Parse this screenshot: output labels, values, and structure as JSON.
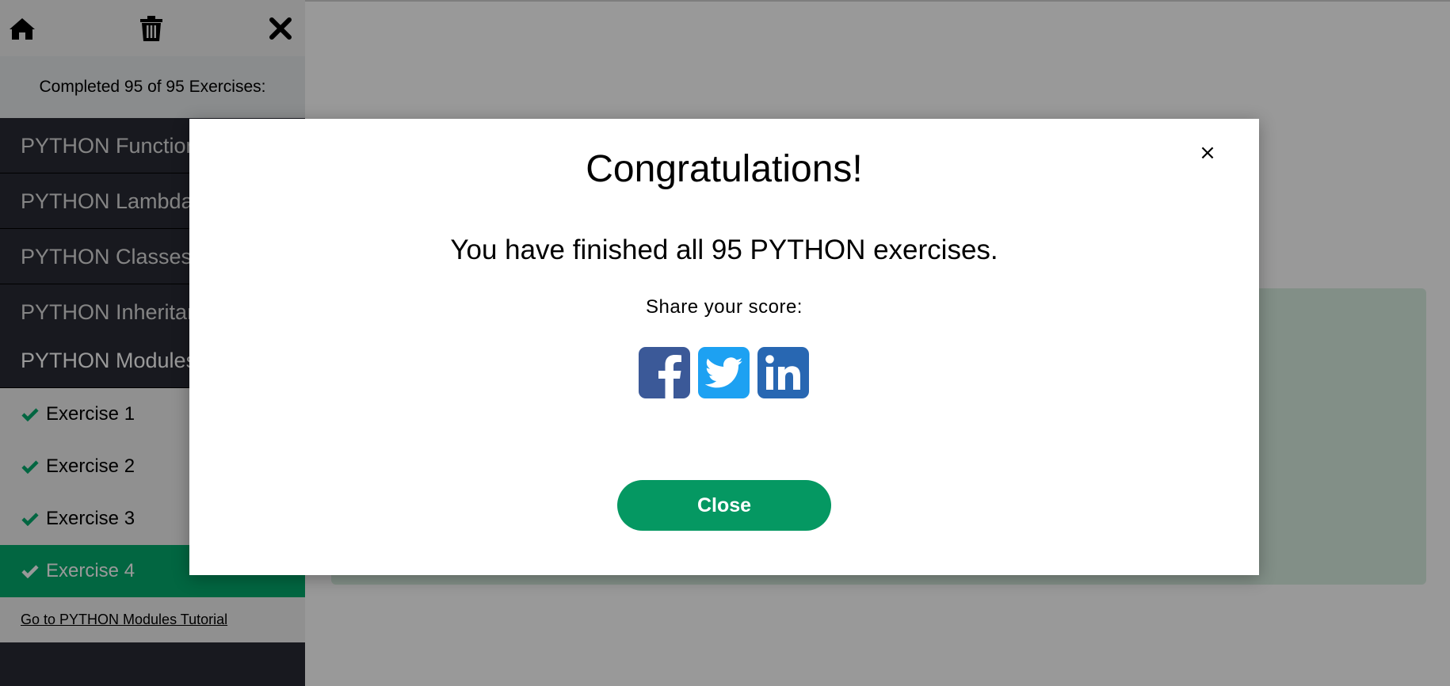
{
  "sidebar": {
    "toolbar": {
      "home_icon": "home-icon",
      "trash_icon": "trash-icon",
      "close_icon": "close-icon"
    },
    "progress_text": "Completed 95 of 95 Exercises:",
    "categories": [
      {
        "label": "PYTHON Functions"
      },
      {
        "label": "PYTHON Lambda"
      },
      {
        "label": "PYTHON Classes"
      },
      {
        "label": "PYTHON Inheritance"
      },
      {
        "label": "PYTHON Modules"
      }
    ],
    "exercises": [
      {
        "label": "Exercise 1",
        "completed": true
      },
      {
        "label": "Exercise 2",
        "completed": true
      },
      {
        "label": "Exercise 3",
        "completed": true
      },
      {
        "label": "Exercise 4",
        "completed": true,
        "current": true
      }
    ],
    "tutorial_link": "Go to PYTHON Modules Tutorial"
  },
  "modal": {
    "close_symbol": "×",
    "title": "Congratulations!",
    "message": "You have finished all 95 PYTHON exercises.",
    "share_label": "Share your score:",
    "social_icons": [
      "facebook-icon",
      "twitter-icon",
      "linkedin-icon"
    ],
    "close_button_label": "Close"
  },
  "colors": {
    "accent_green": "#04aa6d",
    "button_green": "#059862",
    "sidebar_dark": "#282a35",
    "facebook": "#3b5998",
    "twitter": "#1da1f2",
    "linkedin": "#2867b2"
  }
}
